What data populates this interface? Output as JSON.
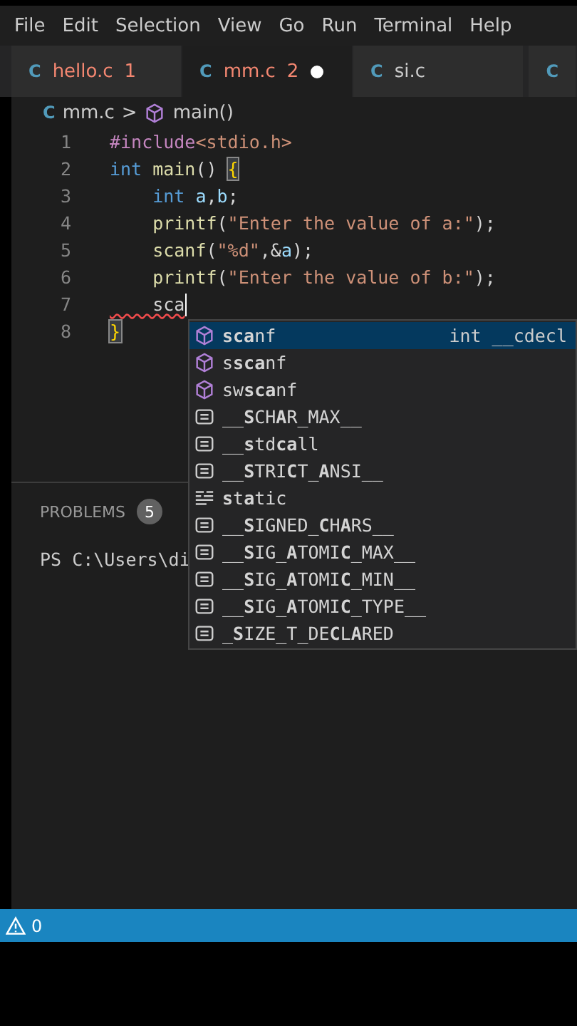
{
  "menu": [
    "File",
    "Edit",
    "Selection",
    "View",
    "Go",
    "Run",
    "Terminal",
    "Help"
  ],
  "tabs": [
    {
      "icon": "C",
      "label": "hello.c",
      "problems": "1",
      "has_errors": true,
      "modified": false,
      "selected": false
    },
    {
      "icon": "C",
      "label": "mm.c",
      "problems": "2",
      "has_errors": true,
      "modified": true,
      "selected": true
    },
    {
      "icon": "C",
      "label": "si.c",
      "has_errors": false,
      "modified": false,
      "selected": false
    },
    {
      "icon": "C",
      "selected": false
    }
  ],
  "breadcrumb": {
    "icon": "C",
    "file": "mm.c",
    "separator": ">",
    "symbol": "main()"
  },
  "code": [
    {
      "number": "1",
      "tokens": [
        {
          "kind": "preproc",
          "text": "#include"
        },
        {
          "kind": "string",
          "text": "<stdio.h>"
        }
      ]
    },
    {
      "number": "2",
      "tokens": [
        {
          "kind": "keyword",
          "text": "int"
        },
        {
          "kind": "func",
          "text": " main"
        },
        {
          "kind": "plain",
          "text": "() "
        },
        {
          "kind": "brace",
          "text": "{"
        }
      ]
    },
    {
      "number": "3",
      "tokens": [
        {
          "kind": "keyword",
          "text": "    int"
        },
        {
          "kind": "var",
          "text": " a"
        },
        {
          "kind": "plain",
          "text": ","
        },
        {
          "kind": "var",
          "text": "b"
        },
        {
          "kind": "plain",
          "text": ";"
        }
      ]
    },
    {
      "number": "4",
      "tokens": [
        {
          "kind": "func",
          "text": "    printf"
        },
        {
          "kind": "plain",
          "text": "("
        },
        {
          "kind": "string",
          "text": "\"Enter the value of a:\""
        },
        {
          "kind": "plain",
          "text": ");"
        }
      ]
    },
    {
      "number": "5",
      "tokens": [
        {
          "kind": "func",
          "text": "    scanf"
        },
        {
          "kind": "plain",
          "text": "("
        },
        {
          "kind": "string",
          "text": "\"%d\""
        },
        {
          "kind": "plain",
          "text": ",&"
        },
        {
          "kind": "var",
          "text": "a"
        },
        {
          "kind": "plain",
          "text": ");"
        }
      ]
    },
    {
      "number": "6",
      "tokens": [
        {
          "kind": "func",
          "text": "    printf"
        },
        {
          "kind": "plain",
          "text": "("
        },
        {
          "kind": "string",
          "text": "\"Enter the value of b:\""
        },
        {
          "kind": "plain",
          "text": ");"
        }
      ]
    },
    {
      "number": "7",
      "tokens": [
        {
          "kind": "error",
          "text": "    sca"
        }
      ],
      "cursor": true
    },
    {
      "number": "8",
      "tokens": [
        {
          "kind": "brace",
          "text": "}"
        }
      ]
    }
  ],
  "suggestions": [
    {
      "kind": "function",
      "label": "**sca**nf",
      "detail": "int __cdecl",
      "selected": true
    },
    {
      "kind": "function",
      "label": "s**sca**nf",
      "selected": false
    },
    {
      "kind": "function",
      "label": "sw**sca**nf",
      "selected": false
    },
    {
      "kind": "macro",
      "label": "__**S**CH**A**R_MAX__",
      "selected": false
    },
    {
      "kind": "macro",
      "label": "__**s**td**ca**ll",
      "selected": false
    },
    {
      "kind": "macro",
      "label": "__**S**TRI**C**T_**A**NSI__",
      "selected": false
    },
    {
      "kind": "keyword",
      "label": "**s**t**a**tic",
      "selected": false
    },
    {
      "kind": "macro",
      "label": "__**S**IGNED_**C**H**A**RS__",
      "selected": false
    },
    {
      "kind": "macro",
      "label": "__**S**IG_**A**TOMI**C**_MAX__",
      "selected": false
    },
    {
      "kind": "macro",
      "label": "__**S**IG_**A**TOMI**C**_MIN__",
      "selected": false
    },
    {
      "kind": "macro",
      "label": "__**S**IG_**A**TOMI**C**_TYPE__",
      "selected": false
    },
    {
      "kind": "macro",
      "label": "_**S**IZE_T_DE**C**L**A**RED",
      "selected": false
    }
  ],
  "panel": {
    "tab": "PROBLEMS",
    "count": "5",
    "terminal": "PS C:\\Users\\di"
  },
  "status_bar": {
    "warnings": "0"
  }
}
